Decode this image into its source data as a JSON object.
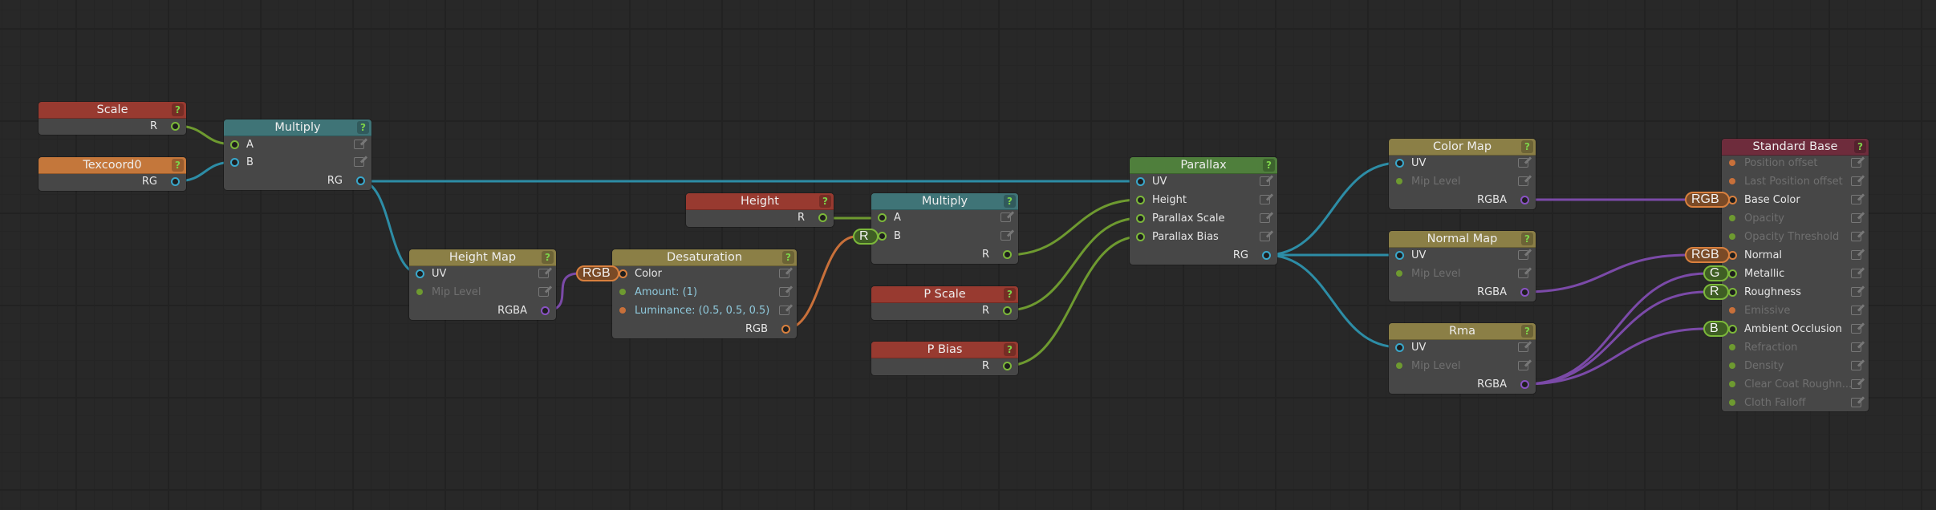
{
  "colors": {
    "wire_blue": "#2d8da6",
    "wire_green": "#6e9a30",
    "wire_orange": "#c8703a",
    "wire_purple": "#7b4aa8",
    "pin_blue": "#3aa8cc",
    "pin_green": "#7cb83a",
    "pin_orange": "#d9803e",
    "pin_purple": "#8a52c4",
    "header_red": "#983a30",
    "header_orange": "#c4773b",
    "header_teal": "#3f7477",
    "header_olive": "#8b7f46",
    "header_green": "#4f7f3c",
    "header_maroon": "#6e2c3c"
  },
  "nodes": {
    "scale": {
      "title": "Scale",
      "help": "?",
      "outputs": [
        "R"
      ]
    },
    "texcoord0": {
      "title": "Texcoord0",
      "help": "?",
      "outputs": [
        "RG"
      ]
    },
    "multiply1": {
      "title": "Multiply",
      "help": "?",
      "inputs": [
        "A",
        "B"
      ],
      "outputs": [
        "RG"
      ]
    },
    "height_map": {
      "title": "Height Map",
      "help": "?",
      "inputs": [
        "UV",
        "Mip Level"
      ],
      "outputs": [
        "RGBA"
      ]
    },
    "desaturation": {
      "title": "Desaturation",
      "help": "?",
      "inputs": [
        "Color",
        "Amount: (1)",
        "Luminance: (0.5, 0.5, 0.5)"
      ],
      "outputs": [
        "RGB"
      ],
      "badge": "RGB"
    },
    "height": {
      "title": "Height",
      "help": "?",
      "outputs": [
        "R"
      ]
    },
    "multiply2": {
      "title": "Multiply",
      "help": "?",
      "inputs": [
        "A",
        "B"
      ],
      "outputs": [
        "R"
      ],
      "badge": "R"
    },
    "p_scale": {
      "title": "P Scale",
      "help": "?",
      "outputs": [
        "R"
      ]
    },
    "p_bias": {
      "title": "P Bias",
      "help": "?",
      "outputs": [
        "R"
      ]
    },
    "parallax": {
      "title": "Parallax",
      "help": "?",
      "inputs": [
        "UV",
        "Height",
        "Parallax Scale",
        "Parallax Bias"
      ],
      "outputs": [
        "RG"
      ]
    },
    "color_map": {
      "title": "Color Map",
      "help": "?",
      "inputs": [
        "UV",
        "Mip Level"
      ],
      "outputs": [
        "RGBA"
      ]
    },
    "normal_map": {
      "title": "Normal Map",
      "help": "?",
      "inputs": [
        "UV",
        "Mip Level"
      ],
      "outputs": [
        "RGBA"
      ]
    },
    "rma": {
      "title": "Rma",
      "help": "?",
      "inputs": [
        "UV",
        "Mip Level"
      ],
      "outputs": [
        "RGBA"
      ]
    },
    "standard_base": {
      "title": "Standard Base",
      "help": "?",
      "inputs": [
        "Position offset",
        "Last Position offset",
        "Base Color",
        "Opacity",
        "Opacity Threshold",
        "Normal",
        "Metallic",
        "Roughness",
        "Emissive",
        "Ambient Occlusion",
        "Refraction",
        "Density",
        "Clear Coat Roughn...",
        "Cloth Falloff"
      ],
      "badges": {
        "base_color": "RGB",
        "normal": "RGB",
        "metallic": "G",
        "roughness": "R",
        "ambient_occlusion": "B"
      }
    }
  }
}
